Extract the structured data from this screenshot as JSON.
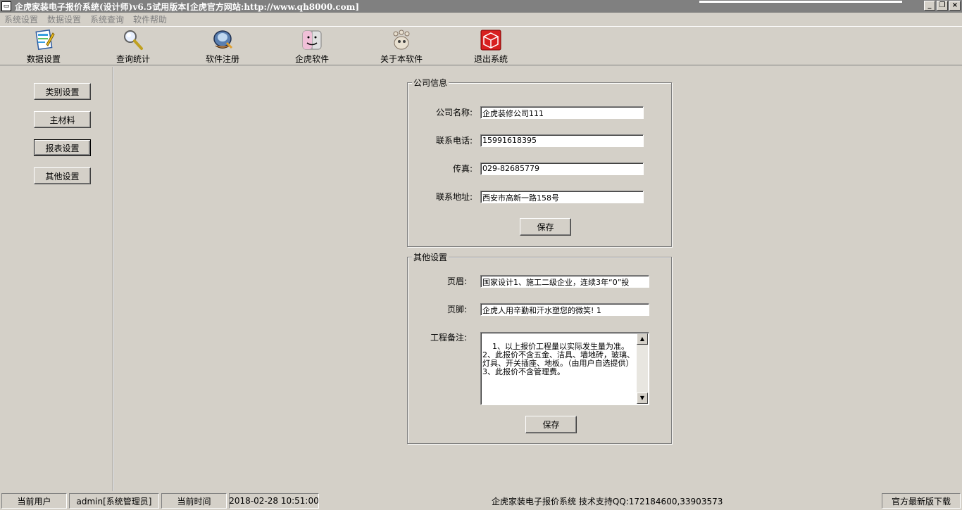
{
  "window": {
    "title": "企虎家装电子报价系统(设计师)v6.5试用版本[企虎官方网站:http://www.qh8000.com]",
    "min": "_",
    "restore": "❐",
    "close": "×"
  },
  "menu": [
    "系统设置",
    "数据设置",
    "系统查询",
    "软件帮助"
  ],
  "toolbar": [
    {
      "label": "数据设置",
      "icon": "data-settings-icon"
    },
    {
      "label": "查询统计",
      "icon": "search-stats-icon"
    },
    {
      "label": "软件注册",
      "icon": "register-icon"
    },
    {
      "label": "企虎软件",
      "icon": "finder-icon"
    },
    {
      "label": "关于本软件",
      "icon": "gimp-icon"
    },
    {
      "label": "退出系统",
      "icon": "exit-cube-icon"
    }
  ],
  "sidebar": [
    "类别设置",
    "主材料",
    "报表设置",
    "其他设置"
  ],
  "company": {
    "group_title": "公司信息",
    "name_label": "公司名称:",
    "name_value": "企虎装修公司111",
    "phone_label": "联系电话:",
    "phone_value": "15991618395",
    "fax_label": "传真:",
    "fax_value": "029-82685779",
    "address_label": "联系地址:",
    "address_value": "西安市高新一路158号",
    "save_label": "保存"
  },
  "other": {
    "group_title": "其他设置",
    "header_label": "页眉:",
    "header_value": "国家设计1、施工二级企业，连续3年“0”投",
    "footer_label": "页脚:",
    "footer_value": "企虎人用辛勤和汗水塑您的微笑! 1",
    "remarks_label": "工程备注:",
    "remarks_value": "1、以上报价工程量以实际发生量为准。\n2、此报价不含五金、洁具、墙地砖，玻璃、灯具、开关插座、地板。（由用户自选提供）\n3、此报价不含管理费。",
    "save_label": "保存"
  },
  "status": {
    "current_user_label": "当前用户",
    "current_user_value": "admin[系统管理员]",
    "current_time_label": "当前时间",
    "current_time_value": "2018-02-28 10:51:00",
    "product_info": "企虎家装电子报价系统  技术支持QQ:172184600,33903573",
    "download_label": "官方最新版下载"
  }
}
